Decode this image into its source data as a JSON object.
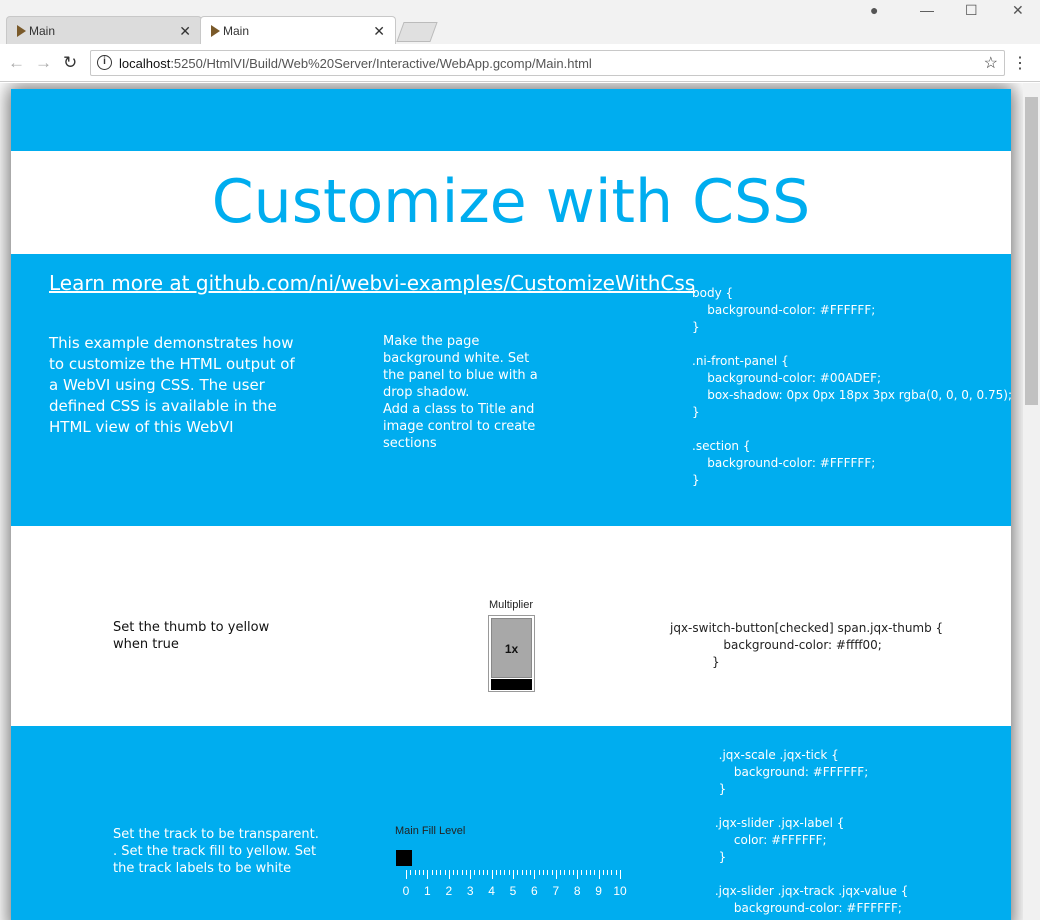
{
  "browser": {
    "tabs": [
      {
        "label": "Main"
      },
      {
        "label": "Main"
      }
    ],
    "url_host": "localhost",
    "url_rest": ":5250/HtmlVI/Build/Web%20Server/Interactive/WebApp.gcomp/Main.html"
  },
  "page": {
    "title": "Customize with CSS",
    "link": "Learn more at github.com/ni/webvi-examples/CustomizeWithCss",
    "description": "This example demonstrates how to customize the HTML output of a WebVI using CSS. The user defined CSS is available in the HTML view of this WebVI",
    "note1": "Make the page background white. Set the panel to blue with a drop shadow.",
    "note2": "Add a class to Title and  image control to create sections",
    "css1": "body {\n    background-color: #FFFFFF;\n}\n\n.ni-front-panel {\n    background-color: #00ADEF;\n    box-shadow: 0px 0px 18px 3px rgba(0, 0, 0, 0.75);\n}\n\n.section {\n    background-color: #FFFFFF;\n}",
    "switch_note": "Set the thumb to yellow when true",
    "switch_label": "Multiplier",
    "switch_value": "1x",
    "css2": "jqx-switch-button[checked] span.jqx-thumb {\n              background-color: #ffff00;\n           }",
    "slider_note": "Set the track to be transparent. . Set the track fill to yellow. Set the track labels to be white",
    "slider_label": "Main Fill Level",
    "slider_value": 0,
    "slider_ticks": [
      "0",
      "1",
      "2",
      "3",
      "4",
      "5",
      "6",
      "7",
      "8",
      "9",
      "10"
    ],
    "css3": "  .jqx-scale .jqx-tick {\n      background: #FFFFFF;\n  }\n\n .jqx-slider .jqx-label {\n      color: #FFFFFF;\n  }\n\n .jqx-slider .jqx-track .jqx-value {\n      background-color: #FFFFFF;"
  }
}
